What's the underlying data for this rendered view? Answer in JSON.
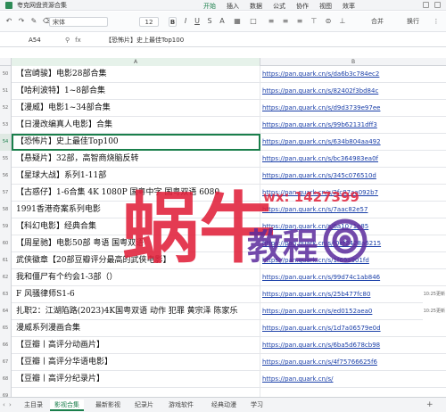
{
  "app": {
    "window_title": "夸克网盘资源合集",
    "ribbon_tabs": [
      "开始",
      "插入",
      "数据",
      "公式",
      "协作",
      "视图",
      "效率"
    ],
    "active_tab": "开始"
  },
  "toolbar": {
    "font_name": "宋体",
    "font_size": "12",
    "bold_label": "B",
    "merge_label": "合并",
    "wrap_label": "换行",
    "more_label": "⋮"
  },
  "formula_bar": {
    "cell_ref": "A54",
    "fx_label": "fx",
    "content": "【恐怖片】史上最佳Top100"
  },
  "columns": [
    "A",
    "B"
  ],
  "rows": [
    {
      "num": "50",
      "a": "【宫崎骏】电影28部合集",
      "b": "https://pan.quark.cn/s/da6b3c784ec2",
      "ts": ""
    },
    {
      "num": "51",
      "a": "【哈利波特】1~8部合集",
      "b": "https://pan.quark.cn/s/82402f3bd84c",
      "ts": ""
    },
    {
      "num": "52",
      "a": "【漫威】电影1~34部合集",
      "b": "https://pan.quark.cn/s/d9d3739e97ee",
      "ts": ""
    },
    {
      "num": "53",
      "a": "【日漫改编真人电影】合集",
      "b": "https://pan.quark.cn/s/99b62131dff3",
      "ts": ""
    },
    {
      "num": "54",
      "a": "【恐怖片】史上最佳Top100",
      "b": "https://pan.quark.cn/s/634b804aa492",
      "ts": ""
    },
    {
      "num": "55",
      "a": "【悬疑片】32部，高智商烧脑反转",
      "b": "https://pan.quark.cn/s/bc364983ea0f",
      "ts": ""
    },
    {
      "num": "56",
      "a": "【星球大战】系列1-11部",
      "b": "https://pan.quark.cn/s/345c076510d",
      "ts": ""
    },
    {
      "num": "57",
      "a": "【古惑仔】1-6合集 4K 1080P 国粤中字 国粤双语 6080",
      "b": "https://pan.quark.cn/s/2fc87aa092b7",
      "ts": ""
    },
    {
      "num": "58",
      "a": "1991香港奇案系列电影",
      "b": "https://pan.quark.cn/s/7aac82e57",
      "ts": ""
    },
    {
      "num": "59",
      "a": "【科幻电影】经典合集",
      "b": "https://pan.quark.cn/s/6a1071e85",
      "ts": ""
    },
    {
      "num": "60",
      "a": "【周星驰】电影50部 粤语 国粤双语",
      "b": "https://pan.quark.cn/s/f0ef2428a6215",
      "ts": ""
    },
    {
      "num": "61",
      "a": "武侠徽章【20部豆瓣评分最高的武侠电影】",
      "b": "https://pan.quark.cn/s/1f69a901fd",
      "ts": ""
    },
    {
      "num": "62",
      "a": "我和僵尸有个约会1-3部（）",
      "b": "https://pan.quark.cn/s/99d74c1ab846",
      "ts": ""
    },
    {
      "num": "63",
      "a": "F 风骚律师S1-6",
      "b": "https://pan.quark.cn/s/25b477fc80",
      "ts": "10:25更新"
    },
    {
      "num": "64",
      "a": "扎职2：江湖陷路(2023)4K国粤双语 动作 犯罪 黄宗泽 陈家乐",
      "b": "https://pan.quark.cn/s/ed0152aea0",
      "ts": "10:25更新"
    },
    {
      "num": "65",
      "a": "漫威系列漫画合集",
      "b": "https://pan.quark.cn/s/1d7a06579e0d",
      "ts": ""
    },
    {
      "num": "66",
      "a": "【豆瓣丨高评分动画片】",
      "b": "https://pan.quark.cn/s/6ba5d678cb98",
      "ts": ""
    },
    {
      "num": "67",
      "a": "【豆瓣丨高评分华语电影】",
      "b": "https://pan.quark.cn/s/4f75766625f6",
      "ts": ""
    },
    {
      "num": "68",
      "a": "【豆瓣丨高评分纪录片】",
      "b": "https://pan.quark.cn/s/",
      "ts": ""
    },
    {
      "num": "69",
      "a": "",
      "b": "",
      "ts": ""
    }
  ],
  "selected_row": "54",
  "sheet_tabs": [
    "主目录",
    "影视合集",
    "最新影视",
    "纪录片",
    "游戏软件",
    "经典动漫",
    "学习"
  ],
  "active_sheet": "影视合集",
  "watermark": {
    "big_text": "蜗牛",
    "sub_text": "教程",
    "contact": "wx: 1427399"
  },
  "colors": {
    "accent": "#1a7f4b",
    "link": "#1a3fa8",
    "watermark_red": "#e0203a",
    "watermark_purple": "#5b2a9c"
  }
}
